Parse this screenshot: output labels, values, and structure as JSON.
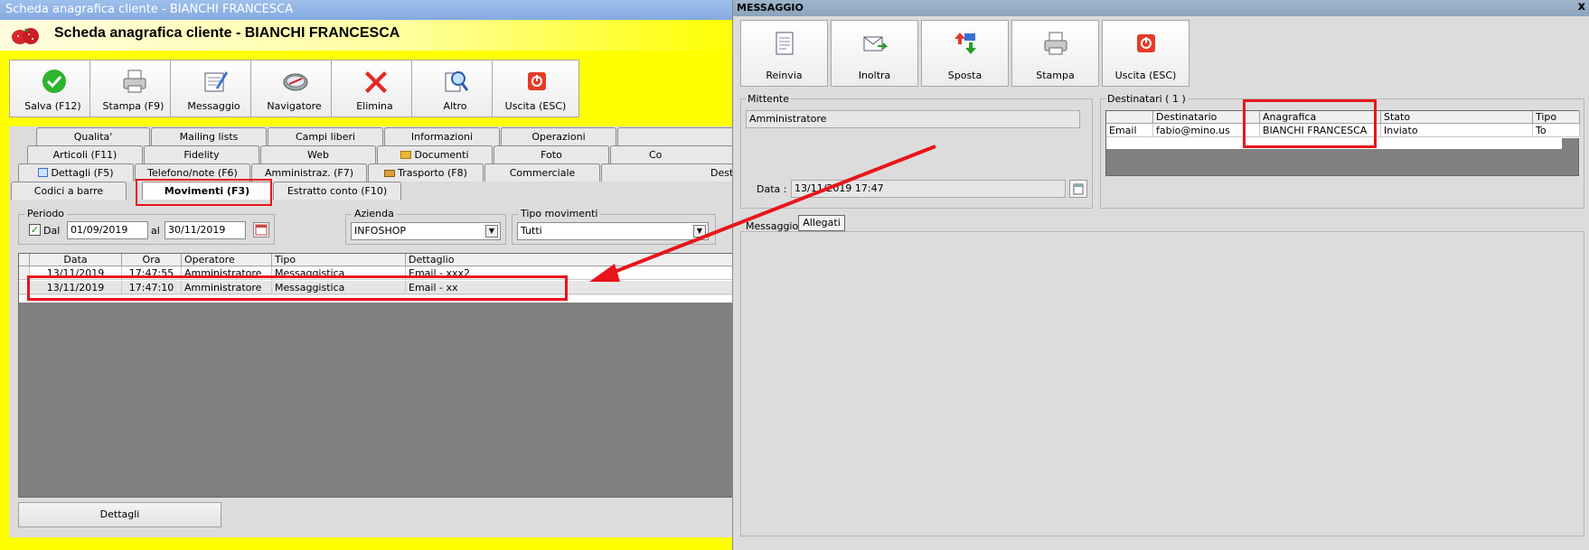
{
  "left_window": {
    "title": "Scheda anagrafica cliente - BIANCHI FRANCESCA",
    "header": "Scheda anagrafica cliente - BIANCHI FRANCESCA",
    "toolbar": [
      {
        "label": "Salva (F12)",
        "icon": "check-icon"
      },
      {
        "label": "Stampa (F9)",
        "icon": "printer-icon"
      },
      {
        "label": "Messaggio",
        "icon": "message-icon"
      },
      {
        "label": "Navigatore",
        "icon": "compass-icon"
      },
      {
        "label": "Elimina",
        "icon": "delete-x-icon"
      },
      {
        "label": "Altro",
        "icon": "magnifier-icon"
      },
      {
        "label": "Uscita (ESC)",
        "icon": "exit-icon"
      }
    ],
    "tabs_row1": [
      "Qualita'",
      "Mailing lists",
      "Campi liberi",
      "Informazioni",
      "Operazioni"
    ],
    "tabs_row2": [
      "Articoli (F11)",
      "Fidelity",
      "Web",
      "Documenti",
      "Foto",
      "Co"
    ],
    "tabs_row3": [
      "Dettagli (F5)",
      "Telefono/note (F6)",
      "Amministraz. (F7)",
      "Trasporto (F8)",
      "Commerciale",
      "Dest"
    ],
    "tabs_row4": [
      "Codici a barre",
      "Movimenti (F3)",
      "Estratto conto (F10)"
    ],
    "periodo": {
      "label": "Periodo",
      "dal_label": "Dal",
      "dal_checked": true,
      "from": "01/09/2019",
      "al_label": "al",
      "to": "30/11/2019"
    },
    "azienda": {
      "label": "Azienda",
      "value": "INFOSHOP"
    },
    "tipo_movimenti": {
      "label": "Tipo movimenti",
      "value": "Tutti"
    },
    "table": {
      "columns": [
        "Data",
        "Ora",
        "Operatore",
        "Tipo",
        "Dettaglio"
      ],
      "rows": [
        [
          "13/11/2019",
          "17:47:55",
          "Amministratore",
          "Messaggistica",
          "Email - xxx2"
        ],
        [
          "13/11/2019",
          "17:47:10",
          "Amministratore",
          "Messaggistica",
          "Email - xx"
        ]
      ]
    },
    "dettagli_button": "Dettagli"
  },
  "right_window": {
    "title": "MESSAGGIO",
    "close": "x",
    "toolbar": [
      {
        "label": "Reinvia",
        "icon": "resend-icon"
      },
      {
        "label": "Inoltra",
        "icon": "forward-mail-icon"
      },
      {
        "label": "Sposta",
        "icon": "move-arrows-icon"
      },
      {
        "label": "Stampa",
        "icon": "printer-icon"
      },
      {
        "label": "Uscita (ESC)",
        "icon": "exit-icon"
      }
    ],
    "mittente": {
      "label": "Mittente",
      "value": "Amministratore"
    },
    "data": {
      "label": "Data :",
      "value": "13/11/2019 17:47"
    },
    "destinatari": {
      "label": "Destinatari ( 1 )",
      "columns": [
        "",
        "Destinatario",
        "Anagrafica",
        "Stato",
        "Tipo"
      ],
      "rows": [
        [
          "Email",
          "fabio@mino.us",
          "BIANCHI FRANCESCA",
          "Inviato",
          "To"
        ]
      ]
    },
    "tabs": [
      "Messaggio",
      "Allegati"
    ]
  },
  "colors": {
    "highlight": "#e8151b",
    "window_bg": "#ffff00",
    "panel_bg": "#dcdcdc"
  }
}
